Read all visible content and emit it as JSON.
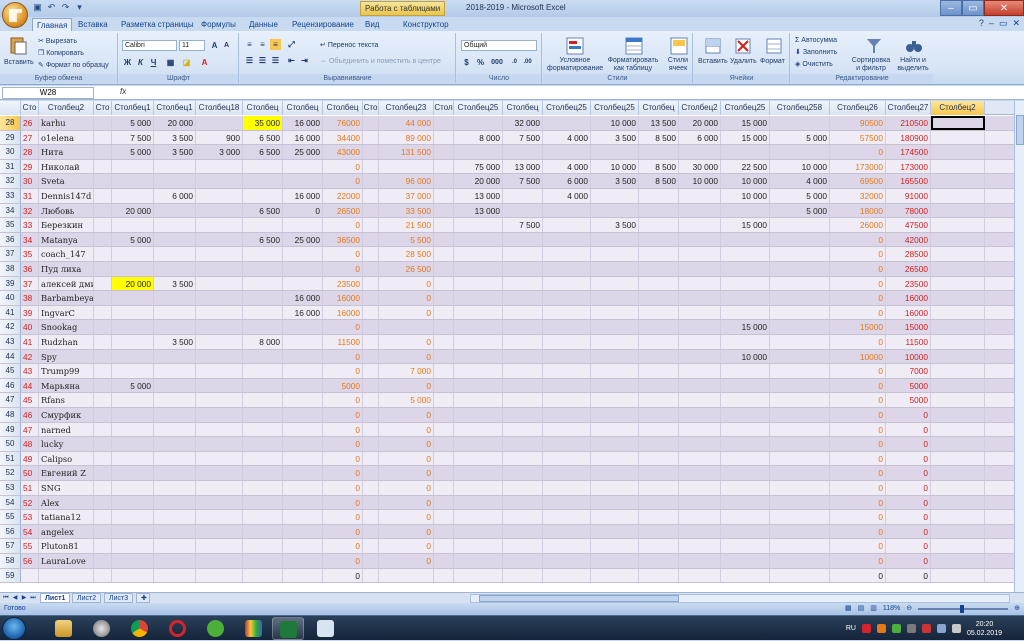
{
  "window": {
    "context_tab": "Работа с таблицами",
    "title": "2018-2019 - Microsoft Excel",
    "minimize": "–",
    "maximize": "▭",
    "close": "✕"
  },
  "ribbon_tabs": [
    "Главная",
    "Вставка",
    "Разметка страницы",
    "Формулы",
    "Данные",
    "Рецензирование",
    "Вид",
    "Конструктор"
  ],
  "ribbon": {
    "clipboard": {
      "paste": "Вставить",
      "cut": "Вырезать",
      "copy": "Копировать",
      "format_painter": "Формат по образцу",
      "label": "Буфер обмена"
    },
    "font": {
      "name": "Calibri",
      "size": "11",
      "bold": "Ж",
      "italic": "К",
      "underline": "Ч",
      "label": "Шрифт"
    },
    "alignment": {
      "wrap": "Перенос текста",
      "merge": "Объединить и поместить в центре",
      "label": "Выравнивание"
    },
    "number": {
      "format": "Общий",
      "percent": "%",
      "thousands": "000",
      "label": "Число"
    },
    "styles": {
      "conditional": "Условное форматирование",
      "as_table": "Форматировать как таблицу",
      "cell_styles": "Стили ячеек",
      "label": "Стили"
    },
    "cells": {
      "insert": "Вставить",
      "delete": "Удалить",
      "format": "Формат",
      "label": "Ячейки"
    },
    "editing": {
      "autosum": "Автосумма",
      "fill": "Заполнить",
      "clear": "Очистить",
      "sort": "Сортировка и фильтр",
      "find": "Найти и выделить",
      "label": "Редактирование"
    }
  },
  "formula_bar": {
    "name_box": "W28",
    "fx": "fx",
    "value": ""
  },
  "columns": [
    "Сто",
    "Столбец2",
    "Сто",
    "Столбец1",
    "Столбец1",
    "Столбец18",
    "Столбец",
    "Столбец",
    "Столбец",
    "Сто",
    "Столбец23",
    "Стол",
    "Столбец25",
    "Столбец",
    "Столбец25",
    "Столбец25",
    "Столбец",
    "Столбец2",
    "Столбец25",
    "Столбец258",
    "Столбец26",
    "Столбец27",
    "Столбец2"
  ],
  "rows": [
    {
      "n": "28",
      "cells": [
        "26",
        "karhu",
        "",
        "5 000",
        "20 000",
        "",
        "35 000",
        "16 000",
        "76000",
        "",
        "44 000",
        "",
        "",
        "32 000",
        "",
        "10 000",
        "13 500",
        "20 000",
        "15 000",
        "",
        "90500",
        "210500",
        ""
      ]
    },
    {
      "n": "29",
      "cells": [
        "27",
        "o1elena",
        "",
        "7 500",
        "3 500",
        "900",
        "6 500",
        "16 000",
        "34400",
        "",
        "89 000",
        "",
        "8 000",
        "7 500",
        "4 000",
        "3 500",
        "8 500",
        "6 000",
        "15 000",
        "5 000",
        "57500",
        "180900",
        ""
      ]
    },
    {
      "n": "30",
      "cells": [
        "28",
        "Нита",
        "",
        "5 000",
        "3 500",
        "3 000",
        "6 500",
        "25 000",
        "43000",
        "",
        "131 500",
        "",
        "",
        "",
        "",
        "",
        "",
        "",
        "",
        "",
        "0",
        "174500",
        ""
      ]
    },
    {
      "n": "31",
      "cells": [
        "29",
        "Николай",
        "",
        "",
        "",
        "",
        "",
        "",
        "0",
        "",
        "",
        "",
        "75 000",
        "13 000",
        "4 000",
        "10 000",
        "8 500",
        "30 000",
        "22 500",
        "10 000",
        "173000",
        "173000",
        ""
      ]
    },
    {
      "n": "32",
      "cells": [
        "30",
        "Sveta",
        "",
        "",
        "",
        "",
        "",
        "",
        "0",
        "",
        "96 000",
        "",
        "20 000",
        "7 500",
        "6 000",
        "3 500",
        "8 500",
        "10 000",
        "10 000",
        "4 000",
        "69500",
        "165500",
        ""
      ]
    },
    {
      "n": "33",
      "cells": [
        "31",
        "Dennis147d",
        "",
        "",
        "6 000",
        "",
        "",
        "16 000",
        "22000",
        "",
        "37 000",
        "",
        "13 000",
        "",
        "4 000",
        "",
        "",
        "",
        "10 000",
        "5 000",
        "32000",
        "91000",
        ""
      ]
    },
    {
      "n": "34",
      "cells": [
        "32",
        "Любовь",
        "",
        "20 000",
        "",
        "",
        "6 500",
        "0",
        "26500",
        "",
        "33 500",
        "",
        "13 000",
        "",
        "",
        "",
        "",
        "",
        "",
        "5 000",
        "18000",
        "78000",
        ""
      ]
    },
    {
      "n": "35",
      "cells": [
        "33",
        "Березкин",
        "",
        "",
        "",
        "",
        "",
        "",
        "0",
        "",
        "21 500",
        "",
        "",
        "7 500",
        "",
        "3 500",
        "",
        "",
        "15 000",
        "",
        "26000",
        "47500",
        ""
      ]
    },
    {
      "n": "36",
      "cells": [
        "34",
        "Matanya",
        "",
        "5 000",
        "",
        "",
        "6 500",
        "25 000",
        "36500",
        "",
        "5 500",
        "",
        "",
        "",
        "",
        "",
        "",
        "",
        "",
        "",
        "0",
        "42000",
        ""
      ]
    },
    {
      "n": "37",
      "cells": [
        "35",
        "coach_147",
        "",
        "",
        "",
        "",
        "",
        "",
        "0",
        "",
        "28 500",
        "",
        "",
        "",
        "",
        "",
        "",
        "",
        "",
        "",
        "0",
        "28500",
        ""
      ]
    },
    {
      "n": "38",
      "cells": [
        "36",
        "Пуд лиха",
        "",
        "",
        "",
        "",
        "",
        "",
        "0",
        "",
        "26 500",
        "",
        "",
        "",
        "",
        "",
        "",
        "",
        "",
        "",
        "0",
        "26500",
        ""
      ]
    },
    {
      "n": "39",
      "cells": [
        "37",
        "алексей дмитриевич",
        "",
        "20 000",
        "3 500",
        "",
        "",
        "",
        "23500",
        "",
        "0",
        "",
        "",
        "",
        "",
        "",
        "",
        "",
        "",
        "",
        "0",
        "23500",
        ""
      ]
    },
    {
      "n": "40",
      "cells": [
        "38",
        "Barbambeya",
        "",
        "",
        "",
        "",
        "",
        "16 000",
        "16000",
        "",
        "0",
        "",
        "",
        "",
        "",
        "",
        "",
        "",
        "",
        "",
        "0",
        "16000",
        ""
      ]
    },
    {
      "n": "41",
      "cells": [
        "39",
        "IngvarC",
        "",
        "",
        "",
        "",
        "",
        "16 000",
        "16000",
        "",
        "0",
        "",
        "",
        "",
        "",
        "",
        "",
        "",
        "",
        "",
        "0",
        "16000",
        ""
      ]
    },
    {
      "n": "42",
      "cells": [
        "40",
        "Snookag",
        "",
        "",
        "",
        "",
        "",
        "",
        "0",
        "",
        "",
        "",
        "",
        "",
        "",
        "",
        "",
        "",
        "15 000",
        "",
        "15000",
        "15000",
        ""
      ]
    },
    {
      "n": "43",
      "cells": [
        "41",
        "Rudzhan",
        "",
        "",
        "3 500",
        "",
        "8 000",
        "",
        "11500",
        "",
        "0",
        "",
        "",
        "",
        "",
        "",
        "",
        "",
        "",
        "",
        "0",
        "11500",
        ""
      ]
    },
    {
      "n": "44",
      "cells": [
        "42",
        "Spy",
        "",
        "",
        "",
        "",
        "",
        "",
        "0",
        "",
        "0",
        "",
        "",
        "",
        "",
        "",
        "",
        "",
        "10 000",
        "",
        "10000",
        "10000",
        ""
      ]
    },
    {
      "n": "45",
      "cells": [
        "43",
        "Trump99",
        "",
        "",
        "",
        "",
        "",
        "",
        "0",
        "",
        "7 000",
        "",
        "",
        "",
        "",
        "",
        "",
        "",
        "",
        "",
        "0",
        "7000",
        ""
      ]
    },
    {
      "n": "46",
      "cells": [
        "44",
        "Марьяна",
        "",
        "5 000",
        "",
        "",
        "",
        "",
        "5000",
        "",
        "0",
        "",
        "",
        "",
        "",
        "",
        "",
        "",
        "",
        "",
        "0",
        "5000",
        ""
      ]
    },
    {
      "n": "47",
      "cells": [
        "45",
        "Rfans",
        "",
        "",
        "",
        "",
        "",
        "",
        "0",
        "",
        "5 000",
        "",
        "",
        "",
        "",
        "",
        "",
        "",
        "",
        "",
        "0",
        "5000",
        ""
      ]
    },
    {
      "n": "48",
      "cells": [
        "46",
        "Смурфик",
        "",
        "",
        "",
        "",
        "",
        "",
        "0",
        "",
        "0",
        "",
        "",
        "",
        "",
        "",
        "",
        "",
        "",
        "",
        "0",
        "0",
        ""
      ]
    },
    {
      "n": "49",
      "cells": [
        "47",
        "narned",
        "",
        "",
        "",
        "",
        "",
        "",
        "0",
        "",
        "0",
        "",
        "",
        "",
        "",
        "",
        "",
        "",
        "",
        "",
        "0",
        "0",
        ""
      ]
    },
    {
      "n": "50",
      "cells": [
        "48",
        "lucky",
        "",
        "",
        "",
        "",
        "",
        "",
        "0",
        "",
        "0",
        "",
        "",
        "",
        "",
        "",
        "",
        "",
        "",
        "",
        "0",
        "0",
        ""
      ]
    },
    {
      "n": "51",
      "cells": [
        "49",
        "Calipso",
        "",
        "",
        "",
        "",
        "",
        "",
        "0",
        "",
        "0",
        "",
        "",
        "",
        "",
        "",
        "",
        "",
        "",
        "",
        "0",
        "0",
        ""
      ]
    },
    {
      "n": "52",
      "cells": [
        "50",
        "Евгений Z",
        "",
        "",
        "",
        "",
        "",
        "",
        "0",
        "",
        "0",
        "",
        "",
        "",
        "",
        "",
        "",
        "",
        "",
        "",
        "0",
        "0",
        ""
      ]
    },
    {
      "n": "53",
      "cells": [
        "51",
        "SNG",
        "",
        "",
        "",
        "",
        "",
        "",
        "0",
        "",
        "0",
        "",
        "",
        "",
        "",
        "",
        "",
        "",
        "",
        "",
        "0",
        "0",
        ""
      ]
    },
    {
      "n": "54",
      "cells": [
        "52",
        "Alex",
        "",
        "",
        "",
        "",
        "",
        "",
        "0",
        "",
        "0",
        "",
        "",
        "",
        "",
        "",
        "",
        "",
        "",
        "",
        "0",
        "0",
        ""
      ]
    },
    {
      "n": "55",
      "cells": [
        "53",
        "tatiana12",
        "",
        "",
        "",
        "",
        "",
        "",
        "0",
        "",
        "0",
        "",
        "",
        "",
        "",
        "",
        "",
        "",
        "",
        "",
        "0",
        "0",
        ""
      ]
    },
    {
      "n": "56",
      "cells": [
        "54",
        "angelex",
        "",
        "",
        "",
        "",
        "",
        "",
        "0",
        "",
        "0",
        "",
        "",
        "",
        "",
        "",
        "",
        "",
        "",
        "",
        "0",
        "0",
        ""
      ]
    },
    {
      "n": "57",
      "cells": [
        "55",
        "Pluton81",
        "",
        "",
        "",
        "",
        "",
        "",
        "0",
        "",
        "0",
        "",
        "",
        "",
        "",
        "",
        "",
        "",
        "",
        "",
        "0",
        "0",
        ""
      ]
    },
    {
      "n": "58",
      "cells": [
        "56",
        "LauraLove",
        "",
        "",
        "",
        "",
        "",
        "",
        "0",
        "",
        "0",
        "",
        "",
        "",
        "",
        "",
        "",
        "",
        "",
        "",
        "0",
        "0",
        ""
      ]
    },
    {
      "n": "59",
      "cells": [
        "",
        "",
        "",
        "",
        "",
        "",
        "",
        "",
        "0",
        "",
        "",
        "",
        "",
        "",
        "",
        "",
        "",
        "",
        "",
        "",
        "0",
        "0",
        ""
      ]
    }
  ],
  "highlighted_cells": [
    [
      "28",
      6
    ],
    [
      "39",
      3
    ]
  ],
  "sheets": [
    "Лист1",
    "Лист2",
    "Лист3"
  ],
  "status": {
    "ready": "Готово",
    "zoom": "118%"
  },
  "taskbar": {
    "lang": "RU",
    "time": "20:20",
    "date": "05.02.2019"
  }
}
